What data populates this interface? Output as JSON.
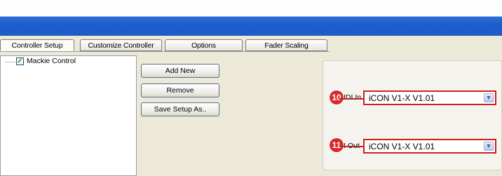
{
  "tabs": [
    "Controller Setup",
    "Customize Controller",
    "Options",
    "Fader Scaling"
  ],
  "tree": {
    "item_label": "Mackie Control",
    "item_checked": true
  },
  "buttons": {
    "add_new": "Add New",
    "remove": "Remove",
    "save_setup_as": "Save Setup As.."
  },
  "ports": {
    "midi_in": {
      "badge": "10",
      "label": "IDI In",
      "value": "iCON V1-X V1.01"
    },
    "midi_out": {
      "badge": "11",
      "label": "I Out",
      "value": "iCON V1-X V1.01"
    }
  },
  "icons": {
    "checkbox": "check-icon",
    "dropdown": "chevron-down-icon"
  },
  "colors": {
    "titlebar": "#1e5cc4",
    "annotation": "#d62b2b"
  }
}
